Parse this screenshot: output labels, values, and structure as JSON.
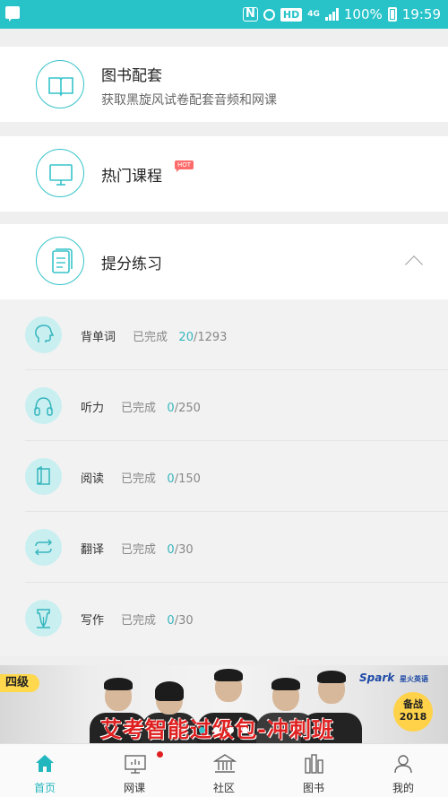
{
  "status_bar": {
    "battery": "100%",
    "time": "19:59",
    "network": "4G",
    "hd": "HD",
    "nfc": "N"
  },
  "cards": {
    "books": {
      "title": "图书配套",
      "subtitle": "获取黑旋风试卷配套音频和网课",
      "icon": "book-icon"
    },
    "courses": {
      "title": "热门课程",
      "badge": "HOT",
      "icon": "monitor-icon"
    },
    "practice": {
      "title": "提分练习",
      "icon": "document-icon",
      "expanded": true
    }
  },
  "practice_items": [
    {
      "label": "背单词",
      "status": "已完成",
      "done": "20",
      "total": "/1293",
      "icon": "head-icon"
    },
    {
      "label": "听力",
      "status": "已完成",
      "done": "0",
      "total": "/250",
      "icon": "headphones-icon"
    },
    {
      "label": "阅读",
      "status": "已完成",
      "done": "0",
      "total": "/150",
      "icon": "book-open-icon"
    },
    {
      "label": "翻译",
      "status": "已完成",
      "done": "0",
      "total": "/30",
      "icon": "swap-icon"
    },
    {
      "label": "写作",
      "status": "已完成",
      "done": "0",
      "total": "/30",
      "icon": "pen-nib-icon"
    }
  ],
  "banner": {
    "level_tag": "四级",
    "brand": "Spark",
    "brand_sub": "星火英语",
    "year_line1": "备战",
    "year_line2": "2018",
    "headline": "艾考智能过级包-冲刺班",
    "active_dot": 0
  },
  "tabs": [
    {
      "label": "首页",
      "icon": "home-icon",
      "active": true
    },
    {
      "label": "网课",
      "icon": "screen-icon",
      "active": false,
      "notification": true
    },
    {
      "label": "社区",
      "icon": "community-icon",
      "active": false
    },
    {
      "label": "图书",
      "icon": "bookshelf-icon",
      "active": false
    },
    {
      "label": "我的",
      "icon": "user-icon",
      "active": false
    }
  ],
  "colors": {
    "accent": "#27c3c9",
    "hot": "#ff6b6b",
    "notification": "#e02020",
    "banner_headline": "#e02020"
  }
}
